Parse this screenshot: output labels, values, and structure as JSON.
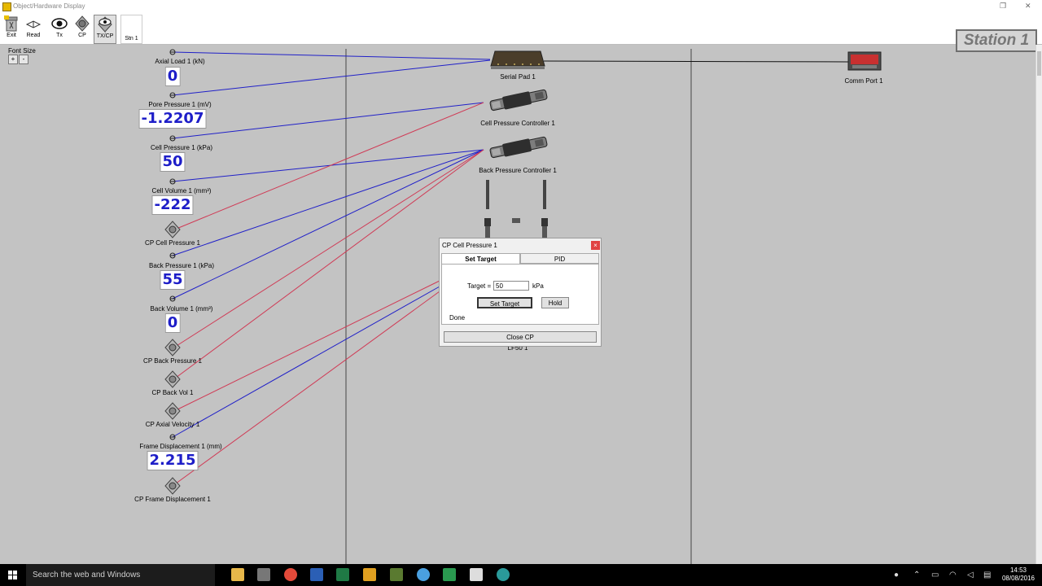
{
  "window": {
    "title": "Object/Hardware Display"
  },
  "toolbar": {
    "buttons": [
      {
        "label": "Exit",
        "icon": "exit-icon"
      },
      {
        "label": "Read",
        "icon": "book-icon"
      },
      {
        "label": "Tx",
        "icon": "eye-icon"
      },
      {
        "label": "CP",
        "icon": "valve-icon"
      },
      {
        "label": "TX/CP",
        "icon": "eye-valve-icon"
      },
      {
        "label": "Stn 1",
        "icon": ""
      }
    ]
  },
  "station_label": "Station 1",
  "font_size": {
    "label": "Font Size",
    "plus": "+",
    "minus": "-"
  },
  "channels": [
    {
      "name": "Axial Load 1  (kN)",
      "value": "0"
    },
    {
      "name": "Pore Pressure 1  (mV)",
      "value": "-1.2207"
    },
    {
      "name": "Cell Pressure 1  (kPa)",
      "value": "50"
    },
    {
      "name": "Cell Volume 1  (mm³)",
      "value": "-222"
    },
    {
      "name": "CP Cell Pressure 1"
    },
    {
      "name": "Back Pressure 1  (kPa)",
      "value": "55"
    },
    {
      "name": "Back Volume 1  (mm³)",
      "value": "0"
    },
    {
      "name": "CP Back Pressure 1"
    },
    {
      "name": "CP Back Vol 1"
    },
    {
      "name": "CP Axial Velocity 1"
    },
    {
      "name": "Frame Displacement 1  (mm)",
      "value": "2.215"
    },
    {
      "name": "CP Frame Displacement 1"
    }
  ],
  "devices": {
    "serial_pad": "Serial Pad 1",
    "cell_pc": "Cell Pressure Controller 1",
    "back_pc": "Back Pressure Controller 1",
    "comm_port": "Comm Port 1",
    "lf50": "LF50 1"
  },
  "dialog": {
    "title": "CP Cell Pressure 1",
    "close_glyph": "×",
    "tabs": [
      "Set Target",
      "PID"
    ],
    "target_label": "Target =",
    "target_value": "50",
    "target_unit": "kPa",
    "set_target_button": "Set Target",
    "hold_button": "Hold",
    "status": "Done",
    "close_button": "Close CP"
  },
  "taskbar": {
    "search_placeholder": "Search the web and Windows",
    "time": "14:53",
    "date": "08/08/2016"
  },
  "colors": {
    "blue_line": "#2020c8",
    "red_line": "#d03a55",
    "value_text": "#1e1ec8"
  }
}
